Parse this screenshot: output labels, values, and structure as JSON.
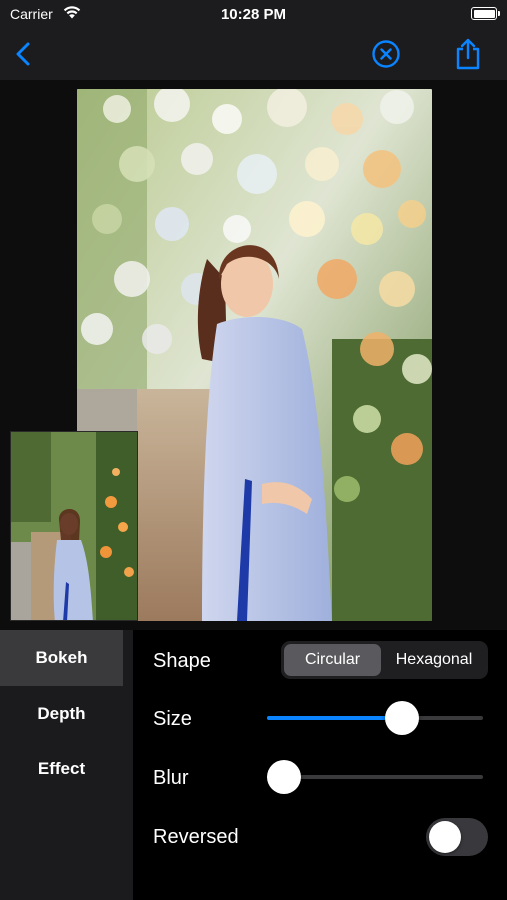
{
  "status_bar": {
    "carrier": "Carrier",
    "time": "10:28 PM"
  },
  "nav_bar": {
    "back_icon": "chevron-left-icon",
    "cancel_icon": "circle-x-icon",
    "share_icon": "share-icon",
    "accent_color": "#0a84ff"
  },
  "side_menu": {
    "items": [
      {
        "label": "Bokeh",
        "active": true
      },
      {
        "label": "Depth",
        "active": false
      },
      {
        "label": "Effect",
        "active": false
      }
    ]
  },
  "settings": {
    "shape": {
      "label": "Shape",
      "options": [
        "Circular",
        "Hexagonal"
      ],
      "selected": "Circular"
    },
    "size": {
      "label": "Size",
      "value_fraction": 0.65
    },
    "blur": {
      "label": "Blur",
      "value_fraction": 0.0
    },
    "reversed": {
      "label": "Reversed",
      "on": false
    }
  }
}
